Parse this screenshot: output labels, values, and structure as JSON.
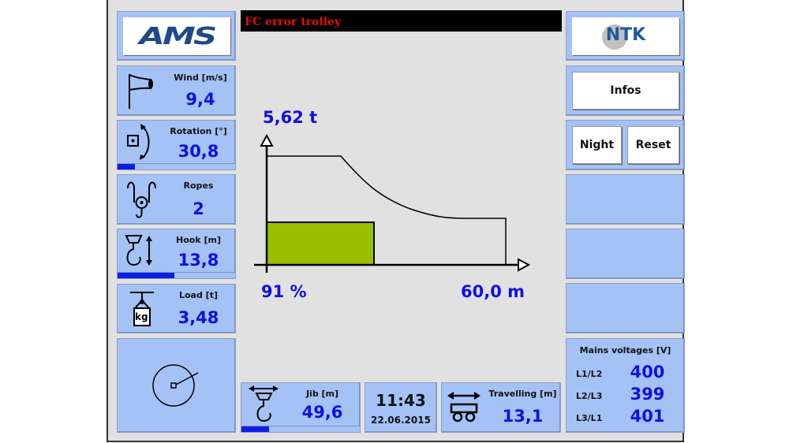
{
  "header": {
    "alarm": "FC error trolley",
    "alarm_color": "#e01010"
  },
  "logos": {
    "left": "AMS",
    "right": "NTK"
  },
  "left": {
    "wind": {
      "label": "Wind [m/s]",
      "value": "9,4",
      "icon": "wind-flag-icon"
    },
    "rotation": {
      "label": "Rotation [°]",
      "value": "30,8",
      "icon": "rotation-icon",
      "progress": 0.15
    },
    "ropes": {
      "label": "Ropes",
      "value": "2",
      "icon": "ropes-hook-icon"
    },
    "hook": {
      "label": "Hook [m]",
      "value": "13,8",
      "icon": "hook-height-icon",
      "progress": 0.48
    },
    "load": {
      "label": "Load [t]",
      "value": "3,48",
      "icon": "load-weight-icon",
      "weight_text": "kg"
    },
    "gauge": {
      "icon": "wind-direction-gauge-icon"
    }
  },
  "chart": {
    "max_load": "5,62 t",
    "load_percent": "91 %",
    "max_radius": "60,0 m",
    "load_fill_color": "#99c000"
  },
  "bottom": {
    "jib": {
      "label": "Jib [m]",
      "value": "49,6",
      "icon": "trolley-hook-icon",
      "progress": 0.23
    },
    "time": "11:43",
    "date": "22.06.2015",
    "travelling": {
      "label": "Travelling [m]",
      "value": "13,1",
      "icon": "travel-carriage-icon"
    }
  },
  "right": {
    "infos": "Infos",
    "night": "Night",
    "reset": "Reset",
    "mains": {
      "title": "Mains voltages [V]",
      "rows": [
        {
          "phase": "L1/L2",
          "value": "400"
        },
        {
          "phase": "L2/L3",
          "value": "399"
        },
        {
          "phase": "L3/L1",
          "value": "401"
        }
      ]
    }
  },
  "colors": {
    "panel": "#a4c2f6",
    "value": "#1010e0",
    "progress": "#0a1ee8"
  }
}
